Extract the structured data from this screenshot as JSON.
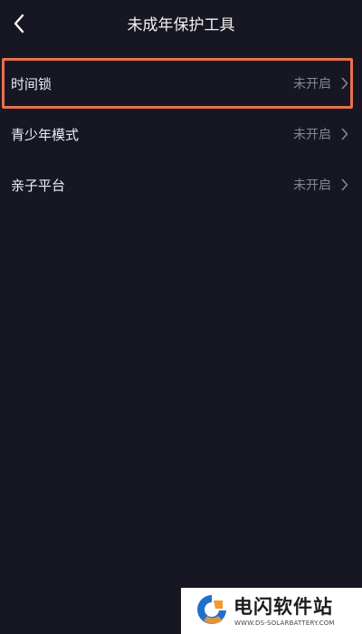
{
  "header": {
    "title": "未成年保护工具",
    "back_icon": "chevron-left-icon"
  },
  "settings": {
    "items": [
      {
        "label": "时间锁",
        "status": "未开启",
        "highlighted": true
      },
      {
        "label": "青少年模式",
        "status": "未开启",
        "highlighted": false
      },
      {
        "label": "亲子平台",
        "status": "未开启",
        "highlighted": false
      }
    ]
  },
  "colors": {
    "background": "#161722",
    "highlight_border": "#e8704d",
    "status_text": "#85868f"
  },
  "watermark": {
    "title": "电闪软件站",
    "url": "WWW.DS-SOLARBATTERY.COM"
  }
}
